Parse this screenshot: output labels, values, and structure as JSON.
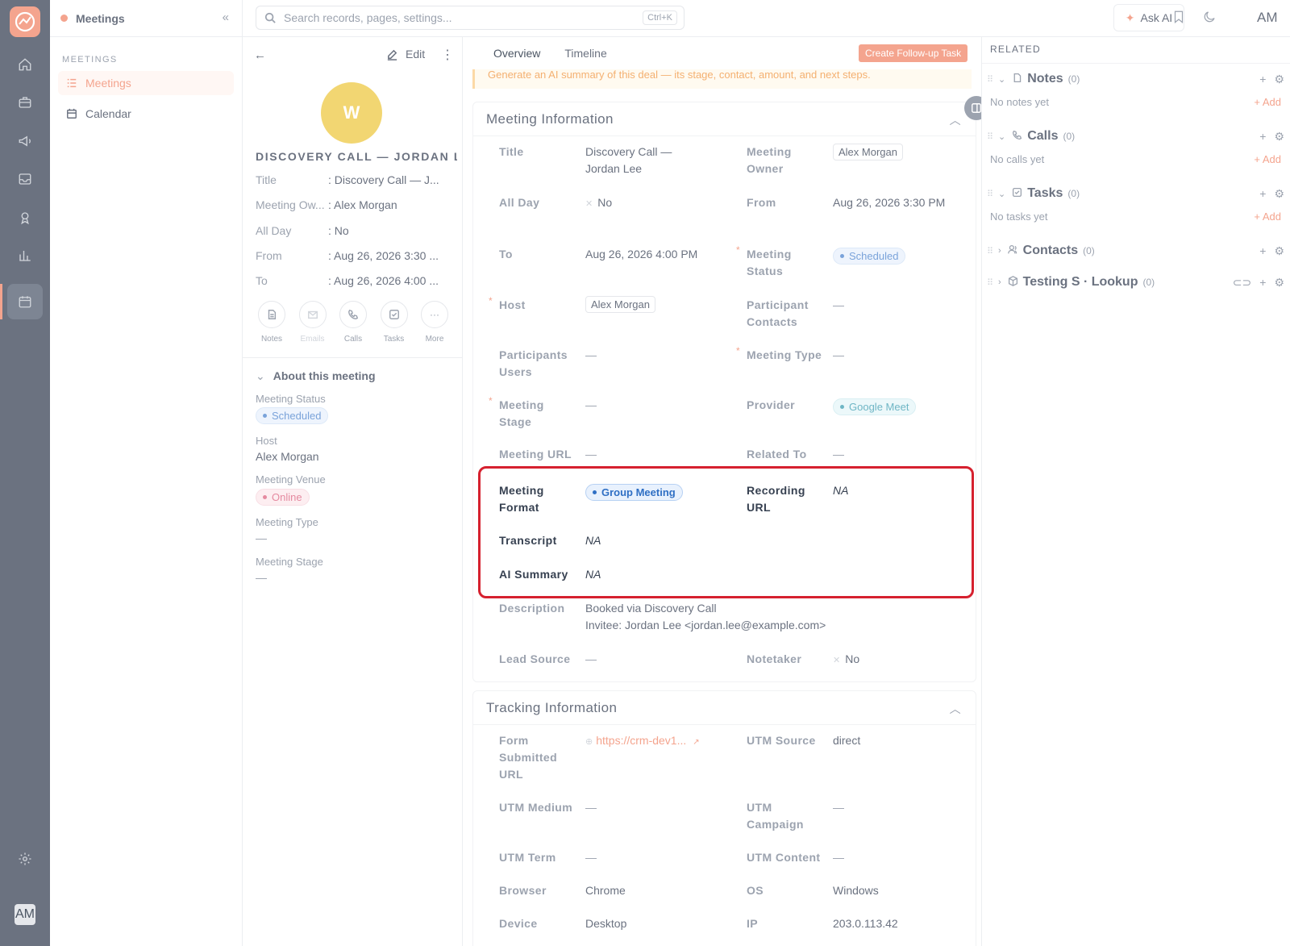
{
  "app": {
    "module": "Meetings",
    "avatar": "AM"
  },
  "nav": {
    "section": "MEETINGS",
    "items": [
      {
        "label": "Meetings",
        "active": true
      },
      {
        "label": "Calendar",
        "active": false
      }
    ]
  },
  "topbar": {
    "search_placeholder": "Search records, pages, settings...",
    "shortcut": "Ctrl+K",
    "ask_ai": "Ask AI",
    "avatar": "AM"
  },
  "profile": {
    "edit_label": "Edit",
    "avatar_letter": "W",
    "name": "DISCOVERY CALL — JORDAN L...",
    "fields": [
      {
        "key": "Title",
        "value": ": Discovery Call — J..."
      },
      {
        "key": "Meeting Ow...",
        "value": ": Alex Morgan"
      },
      {
        "key": "All Day",
        "value": ": No"
      },
      {
        "key": "From",
        "value": ": Aug 26, 2026 3:30 ..."
      },
      {
        "key": "To",
        "value": ": Aug 26, 2026 4:00 ..."
      }
    ],
    "actions": [
      {
        "label": "Notes"
      },
      {
        "label": "Emails"
      },
      {
        "label": "Calls"
      },
      {
        "label": "Tasks"
      },
      {
        "label": "More"
      }
    ],
    "about_title": "About this meeting",
    "about": {
      "status_label": "Meeting Status",
      "status_value": "Scheduled",
      "host_label": "Host",
      "host_value": "Alex Morgan",
      "venue_label": "Meeting Venue",
      "venue_value": "Online",
      "type_label": "Meeting Type",
      "type_value": "—",
      "stage_label": "Meeting Stage",
      "stage_value": "—"
    }
  },
  "main": {
    "tabs": [
      "Overview",
      "Timeline"
    ],
    "followup_button": "Create Follow-up Task",
    "ai_banner": "Generate an AI summary of this deal — its stage, contact, amount, and next steps.",
    "meeting_info": {
      "title": "Meeting Information",
      "title_label": "Title",
      "title_value": "Discovery Call — Jordan Lee",
      "owner_label": "Meeting Owner",
      "owner_value": "Alex Morgan",
      "allday_label": "All Day",
      "allday_value": "No",
      "from_label": "From",
      "from_value": "Aug 26, 2026 3:30 PM",
      "to_label": "To",
      "to_value": "Aug 26, 2026 4:00 PM",
      "status_label": "Meeting Status",
      "status_value": "Scheduled",
      "host_label": "Host",
      "host_value": "Alex Morgan",
      "pc_label": "Participant Contacts",
      "pc_value": "—",
      "pu_label": "Participants Users",
      "pu_value": "—",
      "type_label": "Meeting Type",
      "type_value": "—",
      "stage_label": "Meeting Stage",
      "stage_value": "—",
      "provider_label": "Provider",
      "provider_value": "Google Meet",
      "url_label": "Meeting URL",
      "url_value": "—",
      "related_label": "Related To",
      "related_value": "—",
      "format_label": "Meeting Format",
      "format_value": "Group Meeting",
      "recording_label": "Recording URL",
      "recording_value": "NA",
      "transcript_label": "Transcript",
      "transcript_value": "NA",
      "aisum_label": "AI Summary",
      "aisum_value": "NA",
      "desc_label": "Description",
      "desc_line1": "Booked via Discovery Call",
      "desc_line2": "Invitee: Jordan Lee <jordan.lee@example.com>",
      "lead_label": "Lead Source",
      "lead_value": "—",
      "notetaker_label": "Notetaker",
      "notetaker_value": "No"
    },
    "tracking": {
      "title": "Tracking Information",
      "form_label": "Form Submitted URL",
      "form_value": "https://crm-dev1...",
      "utm_source_label": "UTM Source",
      "utm_source_value": "direct",
      "utm_medium_label": "UTM Medium",
      "utm_medium_value": "—",
      "utm_campaign_label": "UTM Campaign",
      "utm_campaign_value": "—",
      "utm_term_label": "UTM Term",
      "utm_term_value": "—",
      "utm_content_label": "UTM Content",
      "utm_content_value": "—",
      "browser_label": "Browser",
      "browser_value": "Chrome",
      "os_label": "OS",
      "os_value": "Windows",
      "device_label": "Device",
      "device_value": "Desktop",
      "ip_label": "IP",
      "ip_value": "203.0.113.42"
    }
  },
  "related": {
    "title": "RELATED",
    "sections": [
      {
        "name": "Notes",
        "count": "(0)",
        "empty": "No notes yet",
        "add": "+ Add"
      },
      {
        "name": "Calls",
        "count": "(0)",
        "empty": "No calls yet",
        "add": "+ Add"
      },
      {
        "name": "Tasks",
        "count": "(0)",
        "empty": "No tasks yet",
        "add": "+ Add"
      },
      {
        "name": "Contacts",
        "count": "(0)"
      },
      {
        "name": "Testing S · Lookup",
        "count": "(0)"
      }
    ]
  }
}
